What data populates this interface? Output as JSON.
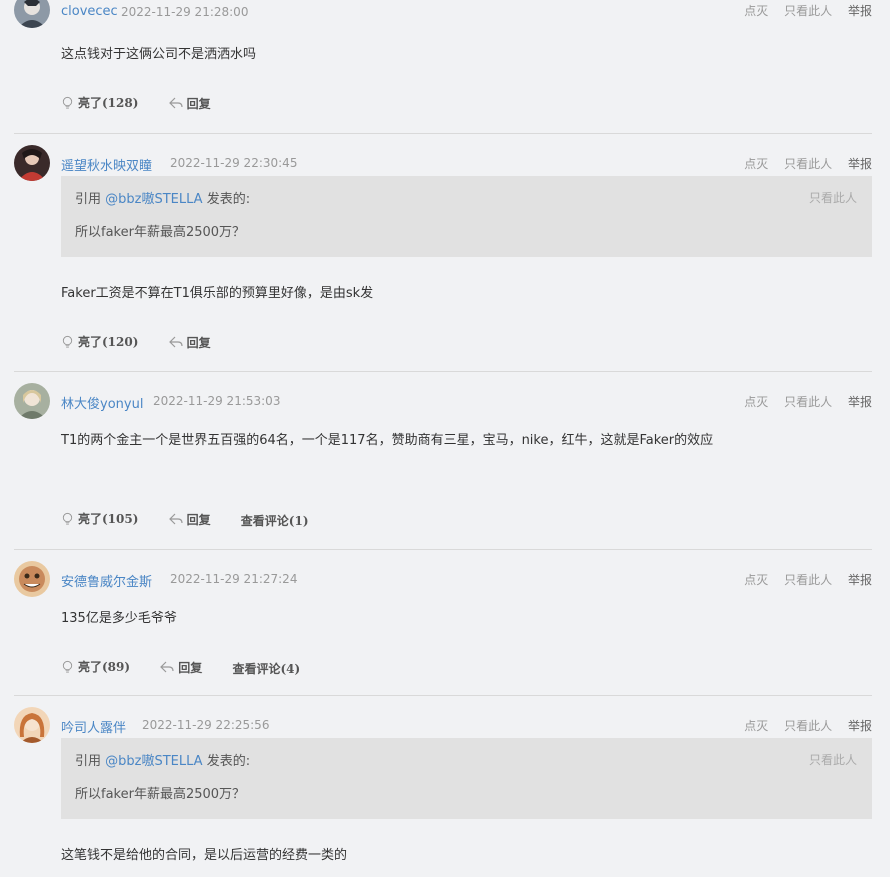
{
  "labels": {
    "dislike": "点灭",
    "only_this": "只看此人",
    "report": "举报",
    "reply": "回复",
    "view_comments": "查看评论"
  },
  "comments": [
    {
      "username": "clovecec",
      "time": "2022-11-29 21:28:00",
      "content": "这点钱对于这俩公司不是洒洒水吗",
      "likes": "亮了(128)",
      "avatar_color": "#5b6a7a"
    },
    {
      "username": "遥望秋水映双瞳",
      "time": "2022-11-29 22:30:45",
      "quote": {
        "prefix": "引用 ",
        "user": "@bbz嗷STELLA",
        "suffix": " 发表的:",
        "text": "所以faker年薪最高2500万？",
        "only_this": "只看此人"
      },
      "content": "Faker工资是不算在T1俱乐部的预算里好像，是由sk发",
      "likes": "亮了(120)",
      "avatar_color": "#b5453e"
    },
    {
      "username": "林大俊yonyul",
      "time": "2022-11-29 21:53:03",
      "content": "T1的两个金主一个是世界五百强的64名，一个是117名，赞助商有三星，宝马，nike，红牛，这就是Faker的效应",
      "likes": "亮了(105)",
      "comments": "查看评论(1)",
      "avatar_color": "#8c9a86"
    },
    {
      "username": "安德鲁威尔金斯",
      "time": "2022-11-29 21:27:24",
      "content": "135亿是多少毛爷爷",
      "likes": "亮了(89)",
      "comments": "查看评论(4)",
      "avatar_color": "#c98a5c"
    },
    {
      "username": "吟司人露伴",
      "time": "2022-11-29 22:25:56",
      "quote": {
        "prefix": "引用 ",
        "user": "@bbz嗷STELLA",
        "suffix": " 发表的:",
        "text": "所以faker年薪最高2500万？",
        "only_this": "只看此人"
      },
      "content": "这笔钱不是给他的合同，是以后运营的经费一类的",
      "avatar_color": "#d08850"
    }
  ]
}
